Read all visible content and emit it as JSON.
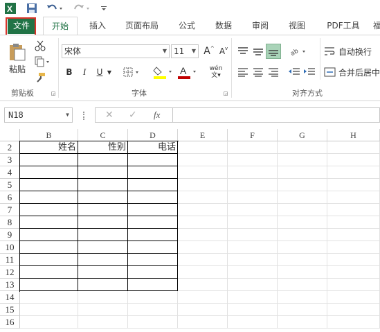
{
  "qat": {
    "icons": [
      "excel-icon",
      "save-icon",
      "undo-icon",
      "redo-icon",
      "customize-icon"
    ]
  },
  "tabs": [
    "文件",
    "开始",
    "插入",
    "页面布局",
    "公式",
    "数据",
    "审阅",
    "视图",
    "PDF工具",
    "福"
  ],
  "ribbon": {
    "clipboard": {
      "paste_label": "粘贴",
      "group_label": "剪贴板"
    },
    "font": {
      "font_name": "宋体",
      "font_size": "11",
      "group_label": "字体",
      "bold": "B",
      "italic": "I",
      "underline": "U",
      "wen": "wén",
      "a_big": "A",
      "a_small": "A"
    },
    "alignment": {
      "wrap_label": "自动换行",
      "merge_label": "合并后居中",
      "group_label": "对齐方式"
    }
  },
  "formula_bar": {
    "name_box": "N18",
    "fx": "fx"
  },
  "sheet": {
    "columns": [
      "B",
      "C",
      "D",
      "E",
      "F",
      "G",
      "H"
    ],
    "rows": [
      "2",
      "3",
      "4",
      "5",
      "6",
      "7",
      "8",
      "9",
      "10",
      "11",
      "12",
      "13",
      "14",
      "15",
      "16"
    ],
    "header_row": {
      "B": "姓名",
      "C": "性别",
      "D": "电话"
    }
  }
}
